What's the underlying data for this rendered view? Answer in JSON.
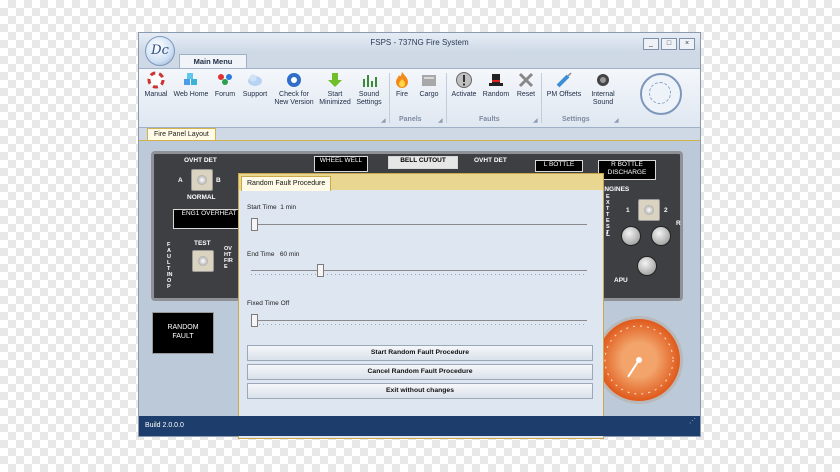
{
  "window": {
    "title": "FSPS - 737NG Fire System",
    "logo_text": "Dc",
    "controls": [
      "_",
      "□",
      "×"
    ]
  },
  "ribbon": {
    "tab": "Main Menu",
    "buttons": [
      {
        "label": "Manual",
        "icon": "life-ring-icon"
      },
      {
        "label": "Web Home",
        "icon": "cubes-icon"
      },
      {
        "label": "Forum",
        "icon": "people-icon"
      },
      {
        "label": "Support",
        "icon": "cloud-icon"
      },
      {
        "label": "Check for New Version",
        "icon": "radio-waves-icon"
      },
      {
        "label": "Start Minimized",
        "icon": "arrow-down-icon"
      },
      {
        "label": "Sound Settings",
        "icon": "equalizer-icon"
      },
      {
        "label": "Fire",
        "icon": "flame-icon"
      },
      {
        "label": "Cargo",
        "icon": "cargo-icon"
      },
      {
        "label": "Activate",
        "icon": "exclamation-icon"
      },
      {
        "label": "Random",
        "icon": "hat-icon"
      },
      {
        "label": "Reset",
        "icon": "x-icon"
      },
      {
        "label": "PM Offsets",
        "icon": "syringe-icon"
      },
      {
        "label": "Internal Sound",
        "icon": "speaker-icon"
      }
    ],
    "groups": [
      "Panels",
      "Faults",
      "Settings"
    ]
  },
  "doc_tab": "Fire Panel Layout",
  "fire_panel": {
    "ovht_det_left": "OVHT DET",
    "a": "A",
    "b": "B",
    "normal": "NORMAL",
    "eng_overheat": "ENG1 OVERHEAT",
    "test": "TEST",
    "fault_inop": "FAULT INOP",
    "ovht_fire": "OVHT FIRE",
    "wheel_well": "WHEEL WELL",
    "bell_cutout": "BELL CUTOUT",
    "ovht_det_right": "OVHT DET",
    "l_bottle": "L BOTTLE",
    "r_bottle": "R BOTTLE DISCHARGE",
    "engines": "ENGINES",
    "ext_test": "EXT TEST",
    "one": "1",
    "two": "2",
    "l": "L",
    "r": "R",
    "apu": "APU",
    "random_fault": "RANDOM FAULT"
  },
  "dialog": {
    "tab": "Random Fault Procedure",
    "start_time_label": "Start Time",
    "start_time_value": "1 min",
    "start_time_position": 0.0,
    "end_time_label": "End Time",
    "end_time_value": "60 min",
    "end_time_position": 0.2,
    "fixed_time_label": "Fixed Time",
    "fixed_time_value": "Off",
    "fixed_time_position": 0.0,
    "start_button": "Start Random Fault Procedure",
    "cancel_button": "Cancel Random Fault Procedure",
    "exit_button": "Exit without changes"
  },
  "statusbar": {
    "build": "Build 2.0.0.0"
  }
}
